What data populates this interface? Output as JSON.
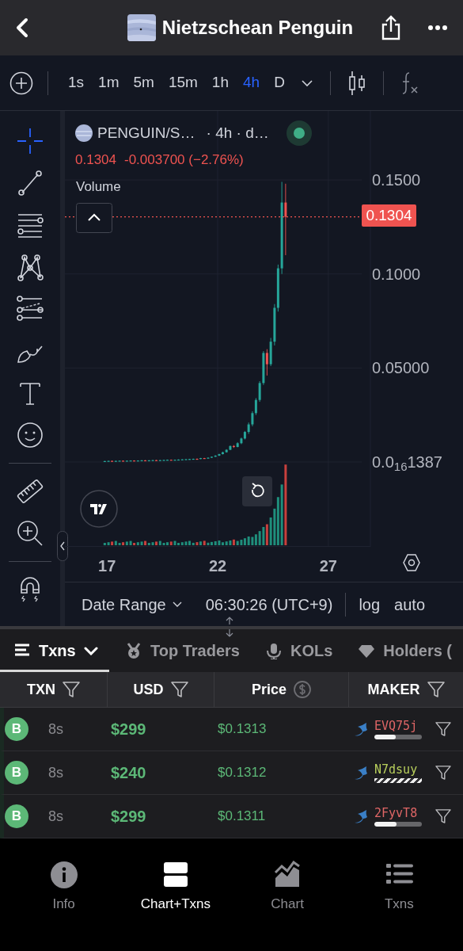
{
  "header": {
    "title": "Nietzschean Penguin"
  },
  "timeframes": [
    {
      "label": "1s",
      "selected": false
    },
    {
      "label": "1m",
      "selected": false
    },
    {
      "label": "5m",
      "selected": false
    },
    {
      "label": "15m",
      "selected": false
    },
    {
      "label": "1h",
      "selected": false
    },
    {
      "label": "4h",
      "selected": true
    },
    {
      "label": "D",
      "selected": false
    }
  ],
  "chart": {
    "symbol": "PENGUIN/S…",
    "interval": "· 4h · d…",
    "last_price": "0.1304",
    "change": "-0.003700 (−2.76%)",
    "volume_label": "Volume",
    "price_tag": "0.1304",
    "chart_data": {
      "type": "candlestick",
      "x": [
        16.9,
        17.07,
        17.23,
        17.4,
        17.57,
        17.73,
        17.9,
        18.07,
        18.23,
        18.4,
        18.57,
        18.73,
        18.9,
        19.07,
        19.23,
        19.4,
        19.57,
        19.73,
        19.9,
        20.07,
        20.23,
        20.4,
        20.57,
        20.73,
        20.9,
        21.07,
        21.23,
        21.4,
        21.57,
        21.73,
        21.9,
        22.07,
        22.23,
        22.4,
        22.57,
        22.73,
        22.9,
        23.07,
        23.23,
        23.4,
        23.57,
        23.73,
        23.9,
        24.07,
        24.23,
        24.4,
        24.57,
        24.73,
        24.9,
        25.07
      ],
      "ohlc": [
        [
          0.0004,
          0.0006,
          0.0003,
          0.0005
        ],
        [
          0.0005,
          0.0007,
          0.0004,
          0.0006
        ],
        [
          0.0006,
          0.0007,
          0.0004,
          0.0005
        ],
        [
          0.0005,
          0.0007,
          0.0004,
          0.0006
        ],
        [
          0.0006,
          0.0008,
          0.0005,
          0.0007
        ],
        [
          0.0007,
          0.0008,
          0.0005,
          0.0006
        ],
        [
          0.0006,
          0.0008,
          0.0005,
          0.0007
        ],
        [
          0.0007,
          0.0009,
          0.0006,
          0.0008
        ],
        [
          0.0008,
          0.0009,
          0.0006,
          0.0007
        ],
        [
          0.0007,
          0.0009,
          0.0006,
          0.0008
        ],
        [
          0.0008,
          0.001,
          0.0007,
          0.0009
        ],
        [
          0.0009,
          0.001,
          0.0007,
          0.0008
        ],
        [
          0.0008,
          0.001,
          0.0007,
          0.0009
        ],
        [
          0.0009,
          0.0011,
          0.0008,
          0.001
        ],
        [
          0.001,
          0.0011,
          0.0008,
          0.0009
        ],
        [
          0.0009,
          0.0011,
          0.0008,
          0.001
        ],
        [
          0.001,
          0.0012,
          0.0009,
          0.0011
        ],
        [
          0.0011,
          0.0013,
          0.001,
          0.0012
        ],
        [
          0.0012,
          0.0013,
          0.001,
          0.0011
        ],
        [
          0.0011,
          0.0013,
          0.001,
          0.0012
        ],
        [
          0.0012,
          0.0014,
          0.0011,
          0.0013
        ],
        [
          0.0013,
          0.0015,
          0.0012,
          0.0014
        ],
        [
          0.0014,
          0.0016,
          0.0013,
          0.0015
        ],
        [
          0.0015,
          0.0017,
          0.0013,
          0.0016
        ],
        [
          0.0016,
          0.0018,
          0.0014,
          0.0017
        ],
        [
          0.0017,
          0.0019,
          0.0015,
          0.0016
        ],
        [
          0.0016,
          0.0022,
          0.0015,
          0.0021
        ],
        [
          0.0021,
          0.0022,
          0.0017,
          0.0019
        ],
        [
          0.0019,
          0.0024,
          0.0018,
          0.0023
        ],
        [
          0.0023,
          0.0029,
          0.0022,
          0.0028
        ],
        [
          0.0028,
          0.0036,
          0.0027,
          0.0034
        ],
        [
          0.0034,
          0.0044,
          0.0032,
          0.0042
        ],
        [
          0.0042,
          0.0055,
          0.004,
          0.0052
        ],
        [
          0.0052,
          0.0068,
          0.005,
          0.0065
        ],
        [
          0.0065,
          0.0088,
          0.0063,
          0.0085
        ],
        [
          0.0085,
          0.009,
          0.0075,
          0.008
        ],
        [
          0.008,
          0.0105,
          0.0078,
          0.01
        ],
        [
          0.01,
          0.013,
          0.0095,
          0.0125
        ],
        [
          0.0125,
          0.0165,
          0.012,
          0.016
        ],
        [
          0.016,
          0.021,
          0.015,
          0.02
        ],
        [
          0.02,
          0.027,
          0.019,
          0.026
        ],
        [
          0.026,
          0.034,
          0.025,
          0.033
        ],
        [
          0.033,
          0.043,
          0.032,
          0.042
        ],
        [
          0.042,
          0.059,
          0.041,
          0.058
        ],
        [
          0.058,
          0.06,
          0.046,
          0.052
        ],
        [
          0.052,
          0.066,
          0.051,
          0.064
        ],
        [
          0.064,
          0.084,
          0.062,
          0.082
        ],
        [
          0.082,
          0.105,
          0.08,
          0.103
        ],
        [
          0.103,
          0.149,
          0.1,
          0.138
        ],
        [
          0.138,
          0.148,
          0.11,
          0.1304
        ]
      ],
      "xlim": [
        15.1,
        28.9
      ],
      "ylim": [
        -0.0451,
        0.1867
      ],
      "grid": true,
      "ref_lines": [
        {
          "axis": "y",
          "value": 0.1304,
          "color": "#ef5350"
        }
      ],
      "xticks": [
        {
          "value": 17,
          "label": "17"
        },
        {
          "value": 22,
          "label": "22"
        },
        {
          "value": 27,
          "label": "27"
        }
      ],
      "yticks": [
        {
          "value": 0.15,
          "label": "0.1500"
        },
        {
          "value": 0.1,
          "label": "0.1000"
        },
        {
          "value": 0.05,
          "label": "0.05000"
        },
        {
          "value": 1.387e-17,
          "label": "0.0$_{16}$1387"
        }
      ]
    }
  },
  "range_bar": {
    "date_range": "Date Range",
    "time": "06:30:26 (UTC+9)",
    "scale_options": [
      "log",
      "auto"
    ]
  },
  "tabs": [
    {
      "label": "Txns",
      "kind": "list",
      "selected": true
    },
    {
      "label": "Top Traders",
      "kind": "medal",
      "selected": false
    },
    {
      "label": "KOLs",
      "kind": "mic",
      "selected": false
    },
    {
      "label": "Holders (",
      "kind": "gem",
      "selected": false
    }
  ],
  "table": {
    "columns": [
      {
        "label": "TXN",
        "kind": "filter"
      },
      {
        "label": "USD",
        "kind": "filter"
      },
      {
        "label": "Price",
        "kind": "dollar"
      },
      {
        "label": "MAKER",
        "kind": "filter"
      }
    ],
    "rows": [
      {
        "side": "B",
        "age": "8s",
        "usd": "$299",
        "price": "$0.1313",
        "maker": "EVQ75j",
        "color": "#e06666",
        "bar": {
          "kind": "meter",
          "level": 0.45
        }
      },
      {
        "side": "B",
        "age": "8s",
        "usd": "$240",
        "price": "$0.1312",
        "maker": "N7dsuy",
        "color": "#b8cf5c",
        "bar": {
          "kind": "striped"
        }
      },
      {
        "side": "B",
        "age": "8s",
        "usd": "$299",
        "price": "$0.1311",
        "maker": "2FyvT8",
        "color": "#e06666",
        "bar": {
          "kind": "meter",
          "level": 0.47
        }
      }
    ]
  },
  "nav": [
    {
      "label": "Info",
      "kind": "info",
      "selected": false
    },
    {
      "label": "Chart+Txns",
      "kind": "split",
      "selected": true
    },
    {
      "label": "Chart",
      "kind": "area",
      "selected": false
    },
    {
      "label": "Txns",
      "kind": "list",
      "selected": false
    }
  ]
}
